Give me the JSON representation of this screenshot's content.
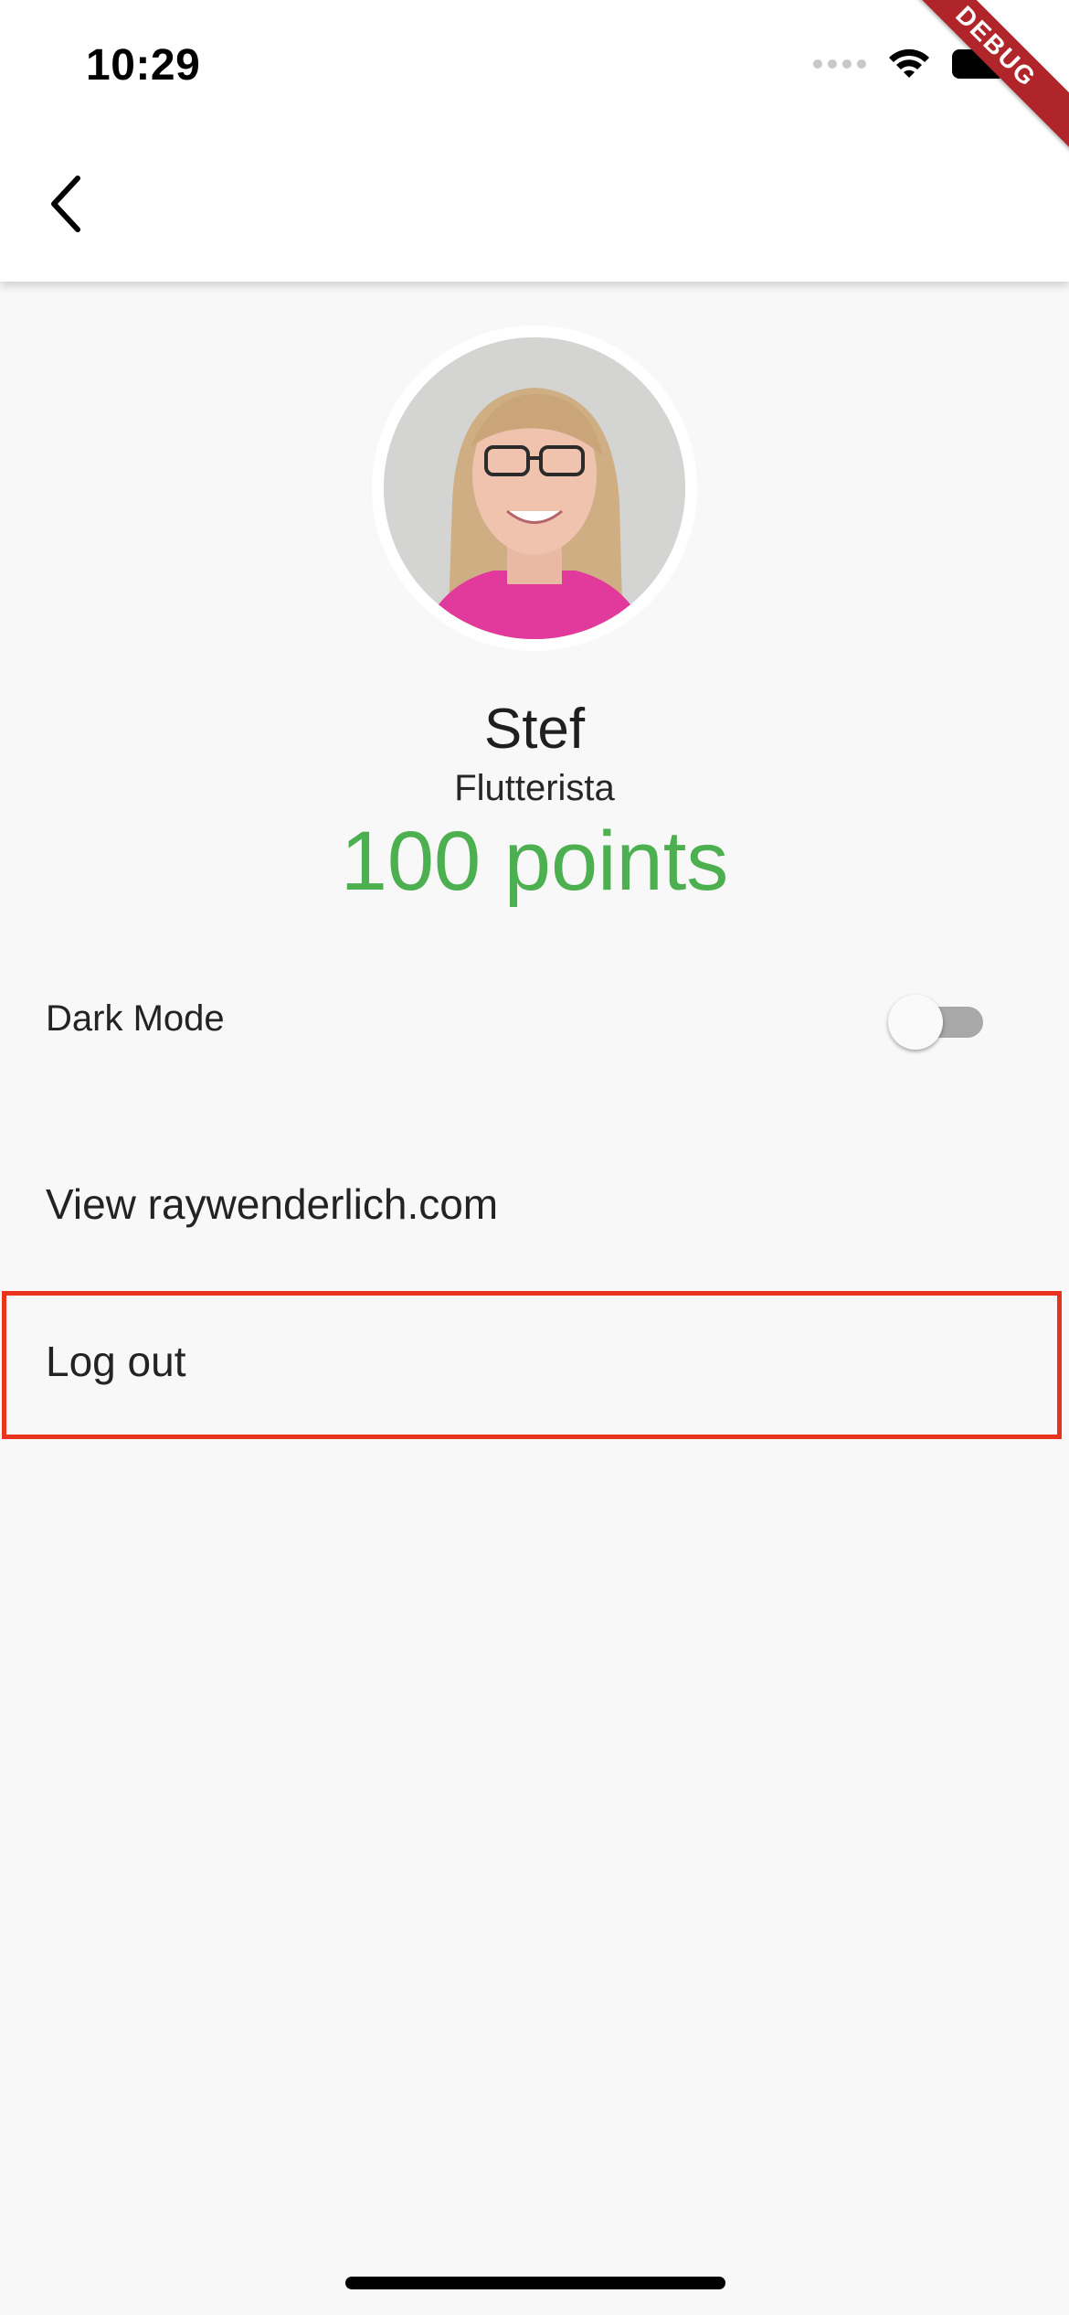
{
  "status_bar": {
    "time": "10:29"
  },
  "debug_banner": {
    "label": "DEBUG"
  },
  "profile": {
    "name": "Stef",
    "role": "Flutterista",
    "points": "100 points"
  },
  "settings": {
    "dark_mode_label": "Dark Mode",
    "dark_mode_enabled": false,
    "website_label": "View raywenderlich.com",
    "logout_label": "Log out"
  },
  "colors": {
    "points": "#4caf50",
    "highlight": "#e8341c",
    "debug_banner": "#b0252a"
  }
}
